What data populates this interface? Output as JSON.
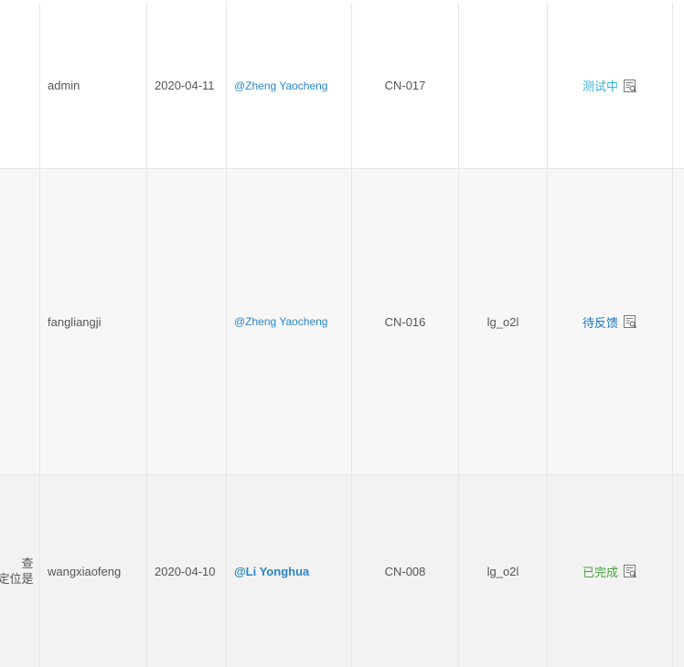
{
  "colors": {
    "testing": "#3db1d6",
    "pending": "#1677c9",
    "done": "#48a43e",
    "mention": "#2a87c7"
  },
  "rows": [
    {
      "description": "",
      "user": "admin",
      "date": "2020-04-11",
      "assignee": "@Zheng Yaocheng",
      "code": "CN-017",
      "tag": "",
      "status": "测试中",
      "status_icon": "document-search-icon"
    },
    {
      "description": "",
      "user": "fangliangji",
      "date": "",
      "assignee": "@Zheng Yaocheng",
      "code": "CN-016",
      "tag": "lg_o2l",
      "status": "待反馈",
      "status_icon": "document-search-icon"
    },
    {
      "description_line1": "查",
      "description_line2": "定位是",
      "user": "wangxiaofeng",
      "date": "2020-04-10",
      "assignee": "@Li Yonghua",
      "code": "CN-008",
      "tag": "lg_o2l",
      "status": "已完成",
      "status_icon": "document-search-icon"
    }
  ]
}
